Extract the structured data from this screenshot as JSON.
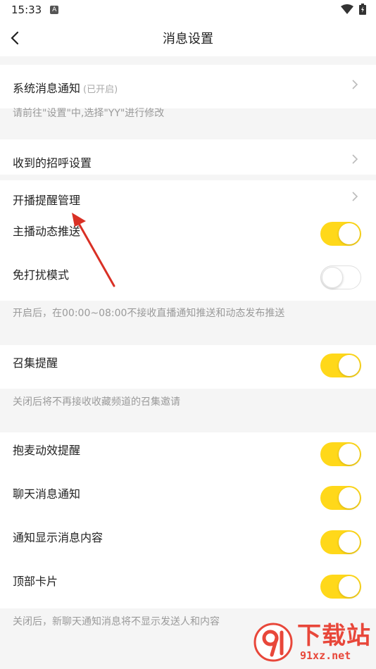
{
  "status_bar": {
    "time": "15:33",
    "notification_badge": "A"
  },
  "header": {
    "title": "消息设置"
  },
  "rows": {
    "system_notify": {
      "label": "系统消息通知",
      "sub": "(已开启)"
    },
    "greeting": {
      "label": "收到的招呼设置"
    },
    "live_reminder": {
      "label": "开播提醒管理"
    },
    "anchor_push": {
      "label": "主播动态推送",
      "enabled": true
    },
    "dnd": {
      "label": "免打扰模式",
      "enabled": false
    },
    "gather": {
      "label": "召集提醒",
      "enabled": true
    },
    "mic_effect": {
      "label": "抱麦动效提醒",
      "enabled": true
    },
    "chat_notify": {
      "label": "聊天消息通知",
      "enabled": true
    },
    "show_content": {
      "label": "通知显示消息内容",
      "enabled": true
    },
    "top_card": {
      "label": "顶部卡片",
      "enabled": true
    }
  },
  "notes": {
    "system_hint": "请前往\"设置\"中,选择\"YY\"进行修改",
    "dnd_hint": "开启后，在00:00~08:00不接收直播通知推送和动态发布推送",
    "gather_hint": "关闭后将不再接收收藏频道的召集邀请",
    "chat_hint": "关闭后，新聊天通知消息将不显示发送人和内容"
  },
  "watermark": {
    "title": "下载站",
    "url": "91xz.net"
  },
  "colors": {
    "toggle_on": "#ffd81a",
    "annotation_arrow": "#d93025",
    "watermark": "#e8473a"
  }
}
